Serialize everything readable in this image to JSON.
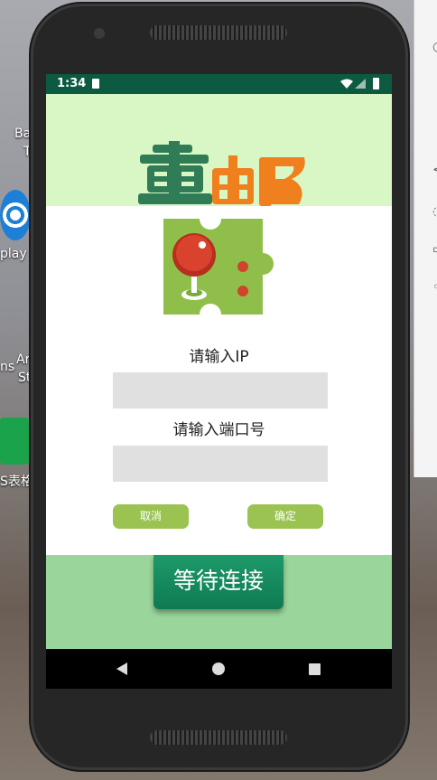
{
  "desktop": {
    "icons": [
      {
        "label": "Ba"
      },
      {
        "label": "T"
      },
      {
        "label": "play"
      },
      {
        "label": "ns"
      },
      {
        "label": "Ar"
      },
      {
        "label": "St"
      },
      {
        "label": "S表格"
      }
    ]
  },
  "statusbar": {
    "time": "1:34"
  },
  "logo": {
    "text": "重邮"
  },
  "dialog": {
    "ip_label": "请输入IP",
    "ip_value": "",
    "port_label": "请输入端口号",
    "port_value": "",
    "cancel_label": "取消",
    "confirm_label": "确定"
  },
  "main": {
    "wait_button_label": "等待连接"
  },
  "colors": {
    "status_bar": "#0d5a43",
    "top_banner": "#d9f7c4",
    "bottom_area": "#9ad69b",
    "small_button": "#9bc352",
    "wait_button": "#0f7a52"
  }
}
